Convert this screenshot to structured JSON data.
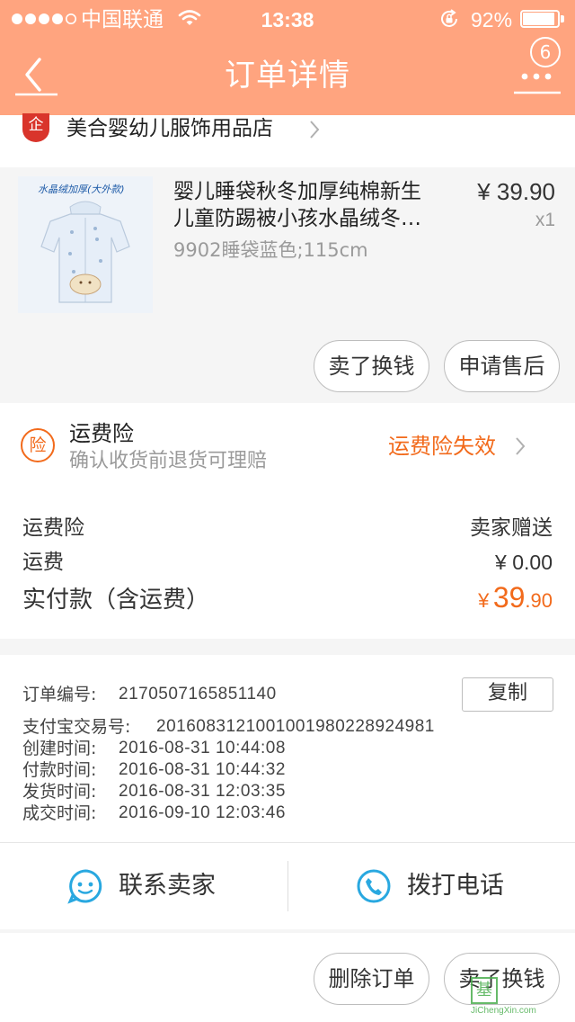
{
  "status_bar": {
    "carrier": "中国联通",
    "time": "13:38",
    "battery": "92%",
    "battery_level": 0.92
  },
  "header": {
    "title": "订单详情",
    "badge": "6"
  },
  "shop": {
    "badge_char": "企",
    "name": "美合婴幼儿服饰用品店"
  },
  "product": {
    "image_label": "水晶绒加厚(大外款)",
    "title_line1": "婴儿睡袋秋冬加厚纯棉新生",
    "title_line2": "儿童防踢被小孩水晶绒冬…",
    "sku": "9902睡袋蓝色;115cm",
    "price": "¥ 39.90",
    "quantity": "x1",
    "actions": [
      "卖了换钱",
      "申请售后"
    ]
  },
  "insurance": {
    "icon_char": "险",
    "title": "运费险",
    "subtitle": "确认收货前退货可理赔",
    "status": "运费险失效"
  },
  "costs": {
    "row1_label": "运费险",
    "row1_value": "卖家赠送",
    "row2_label": "运费",
    "row2_value": "¥ 0.00",
    "total_label": "实付款（含运费）",
    "total_currency": "¥",
    "total_integer": "39",
    "total_decimal": ".90"
  },
  "order_info": {
    "order_no_label": "订单编号:",
    "order_no": "2170507165851140",
    "copy_label": "复制",
    "alipay_label": "支付宝交易号:",
    "alipay_no": "2016083121001001980228924981",
    "created_label": "创建时间:",
    "created": "2016-08-31 10:44:08",
    "paid_label": "付款时间:",
    "paid": "2016-08-31 10:44:32",
    "shipped_label": "发货时间:",
    "shipped": "2016-08-31 12:03:35",
    "completed_label": "成交时间:",
    "completed": "2016-09-10 12:03:46"
  },
  "contact": {
    "seller_label": "联系卖家",
    "phone_label": "拨打电话"
  },
  "bottom_actions": {
    "delete_label": "删除订单",
    "sell_label": "卖了换钱"
  },
  "watermark": {
    "char": "基",
    "text": "JiChengXin.com"
  },
  "colors": {
    "header": "#FFA47F",
    "accent_orange": "#F26A1B",
    "icon_blue": "#29A8E0",
    "shop_red": "#D9342B"
  }
}
